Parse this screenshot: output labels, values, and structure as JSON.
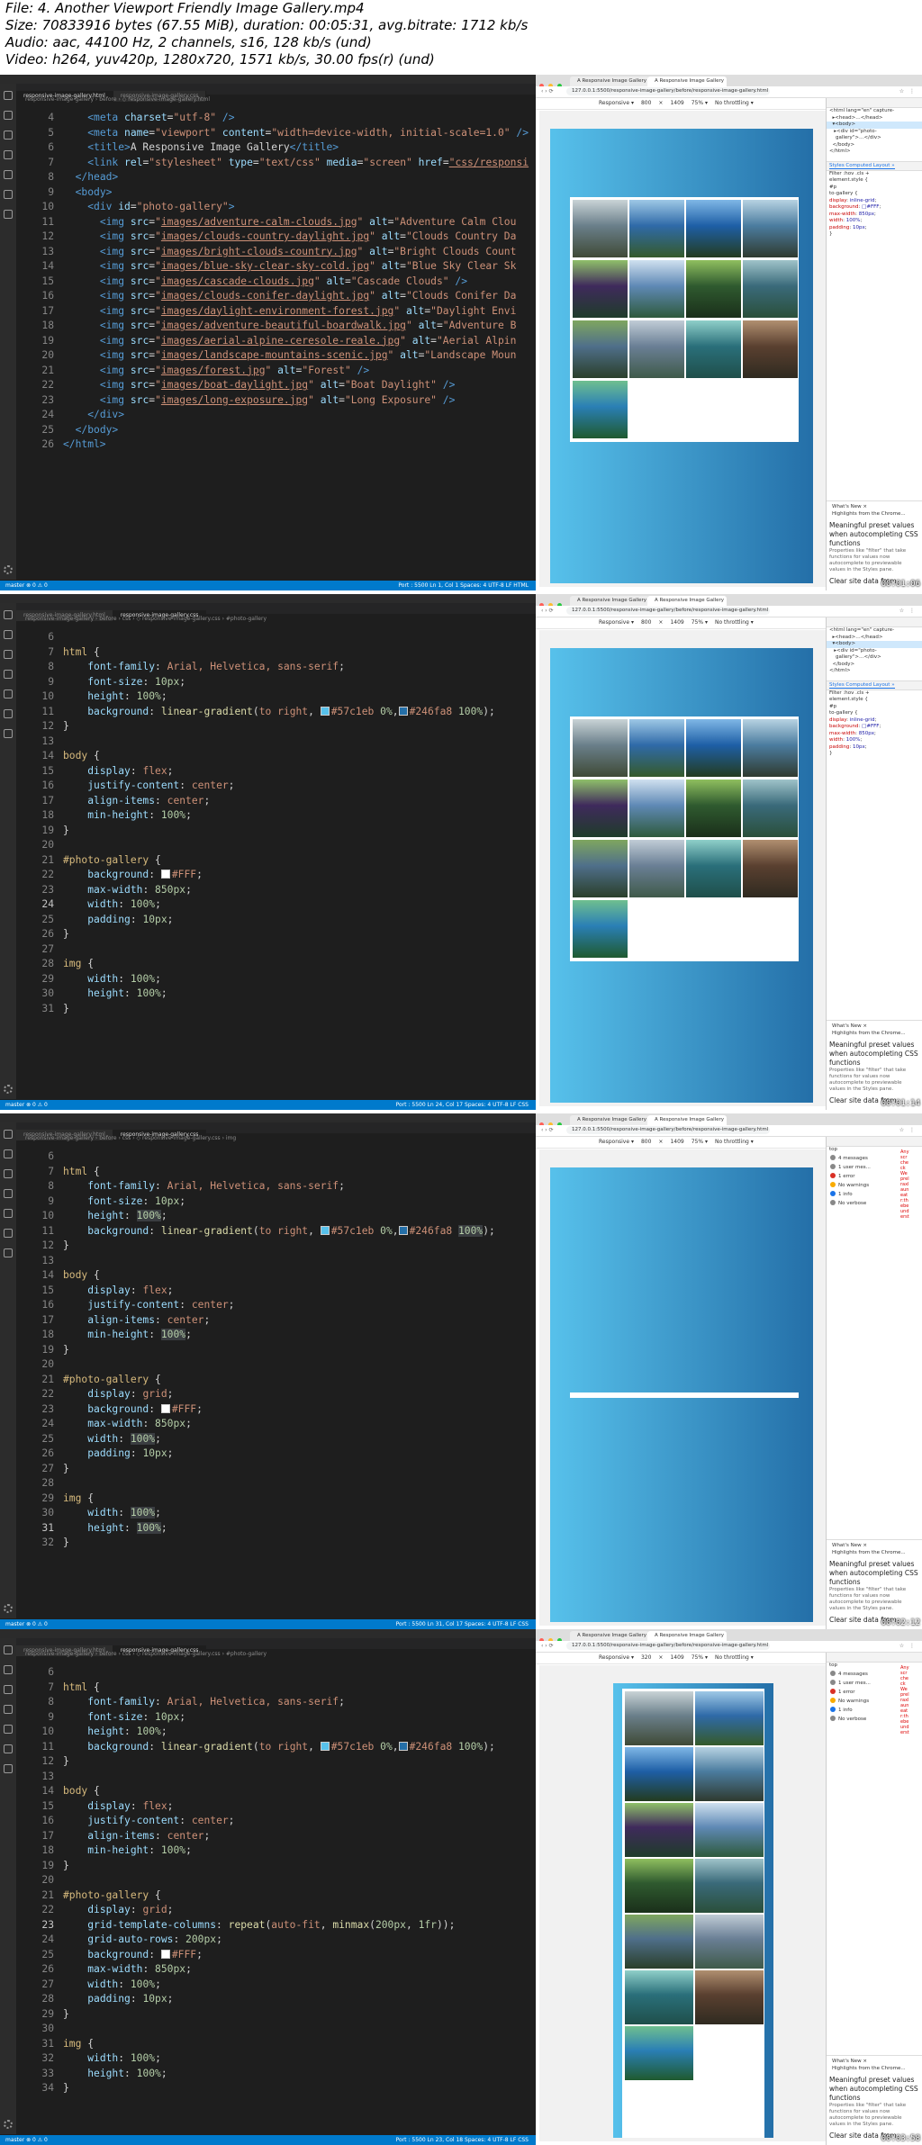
{
  "header": {
    "file": "File: 4. Another Viewport Friendly Image Gallery.mp4",
    "size": "Size: 70833916 bytes (67.55 MiB), duration: 00:05:31, avg.bitrate: 1712 kb/s",
    "audio": "Audio: aac, 44100 Hz, 2 channels, s16, 128 kb/s (und)",
    "video": "Video: h264, yuv420p, 1280x720, 1571 kb/s, 30.00 fps(r) (und)"
  },
  "colors": {
    "grad_start": "#57c1eb",
    "grad_end": "#246fa8",
    "statusbar": "#007acc",
    "white": "#FFF"
  },
  "frames": [
    {
      "timestamp": "00:01:06",
      "editor": {
        "tabs": [
          "responsive-image-gallery.html",
          "responsive-image-gallery.css"
        ],
        "active_tab": 0,
        "breadcrumb": "responsive-image-gallery › before › ◇ responsive-image-gallery.html",
        "status_left": "master  ⊗ 0 ⚠ 0",
        "status_right": "Port : 5500   Ln 1, Col 1   Spaces: 4   UTF-8   LF   HTML"
      },
      "browser": {
        "tabs": [
          "A Responsive Image Gallery",
          "A Responsive Image Gallery"
        ],
        "url": "127.0.0.1:5500/responsive-image-gallery/before/responsive-image-gallery.html",
        "device": "Responsive ▾",
        "width": "800",
        "height": "1409",
        "zoom": "75% ▾",
        "throttle": "No throttling ▾",
        "mode": "elements"
      }
    },
    {
      "timestamp": "00:01:14",
      "editor": {
        "tabs": [
          "responsive-image-gallery.html",
          "responsive-image-gallery.css"
        ],
        "active_tab": 1,
        "breadcrumb": "responsive-image-gallery › before › css › ◇ responsive-image-gallery.css › #photo-gallery",
        "status_left": "master  ⊗ 0 ⚠ 0",
        "status_right": "Port : 5500   Ln 24, Col 17   Spaces: 4   UTF-8   LF   CSS"
      },
      "browser": {
        "tabs": [
          "A Responsive Image Gallery",
          "A Responsive Image Gallery"
        ],
        "url": "127.0.0.1:5500/responsive-image-gallery/before/responsive-image-gallery.html",
        "device": "Responsive ▾",
        "width": "800",
        "height": "1409",
        "zoom": "75% ▾",
        "throttle": "No throttling ▾",
        "mode": "elements"
      }
    },
    {
      "timestamp": "00:02:12",
      "editor": {
        "tabs": [
          "responsive-image-gallery.html",
          "responsive-image-gallery.css"
        ],
        "active_tab": 1,
        "breadcrumb": "responsive-image-gallery › before › css › ◇ responsive-image-gallery.css › img",
        "status_left": "master  ⊗ 0 ⚠ 0",
        "status_right": "Port : 5500   Ln 31, Col 17   Spaces: 4   UTF-8   LF   CSS"
      },
      "browser": {
        "tabs": [
          "A Responsive Image Gallery",
          "A Responsive Image Gallery"
        ],
        "url": "127.0.0.1:5500/responsive-image-gallery/before/responsive-image-gallery.html",
        "device": "Responsive ▾",
        "width": "800",
        "height": "1409",
        "zoom": "75% ▾",
        "throttle": "No throttling ▾",
        "mode": "console"
      }
    },
    {
      "timestamp": "00:03:58",
      "editor": {
        "tabs": [
          "responsive-image-gallery.html",
          "responsive-image-gallery.css"
        ],
        "active_tab": 1,
        "breadcrumb": "responsive-image-gallery › before › css › ◇ responsive-image-gallery.css › #photo-gallery",
        "status_left": "master  ⊗ 0 ⚠ 0",
        "status_right": "Port : 5500   Ln 23, Col 18   Spaces: 4   UTF-8   LF   CSS"
      },
      "browser": {
        "tabs": [
          "A Responsive Image Gallery",
          "A Responsive Image Gallery"
        ],
        "url": "127.0.0.1:5500/responsive-image-gallery/before/responsive-image-gallery.html",
        "device": "Responsive ▾",
        "width": "320",
        "height": "1409",
        "zoom": "75% ▾",
        "throttle": "No throttling ▾",
        "mode": "console"
      }
    }
  ],
  "devtools": {
    "tabs": "Styles  Computed  Layout  »",
    "filter": "Filter                :hov  .cls  +",
    "element_style": "element.style {",
    "whats_new": "What's New  ×",
    "highlights": "Highlights from the Chrome...",
    "headline": "Meaningful preset values when autocompleting CSS functions",
    "desc": "Properties like \"filter\" that take functions for values now autocomplete to previewable values in the Styles pane.",
    "clear": "Clear site data from",
    "console": [
      "4 messages",
      "1 user mes...",
      "1 error",
      "No warnings",
      "1 info",
      "No verbose"
    ],
    "top": "top"
  }
}
